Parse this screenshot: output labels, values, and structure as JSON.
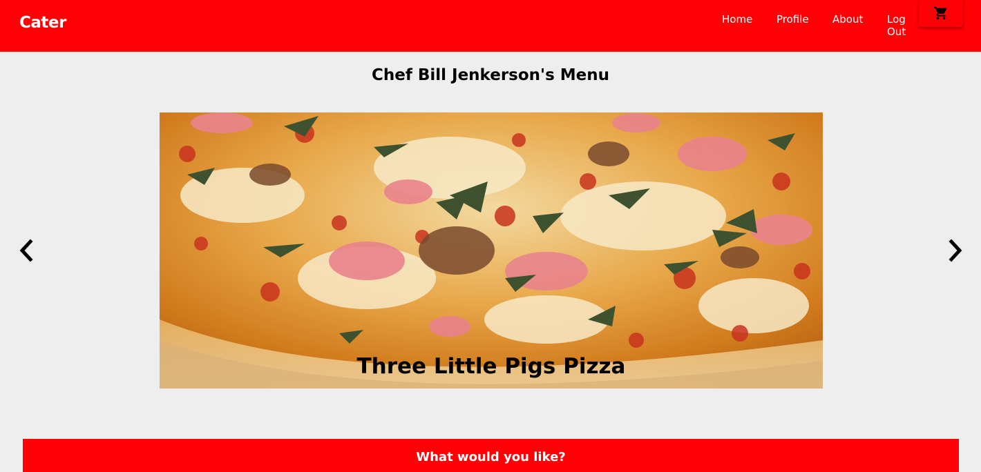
{
  "navbar": {
    "brand": "Cater",
    "links": {
      "home": "Home",
      "profile": "Profile",
      "about": "About",
      "logout": "Log Out"
    },
    "cart_icon": "shopping-cart-icon",
    "background_color": "#ff0007"
  },
  "menu": {
    "title": "Chef Bill Jenkerson's Menu",
    "carousel": {
      "prev_icon": "chevron-left-icon",
      "next_icon": "chevron-right-icon",
      "current_slide": {
        "caption": "Three Little Pigs Pizza"
      }
    }
  },
  "order": {
    "prompt": "What would you like?"
  },
  "colors": {
    "accent": "#ff0007",
    "page_background": "#eeeeee"
  }
}
